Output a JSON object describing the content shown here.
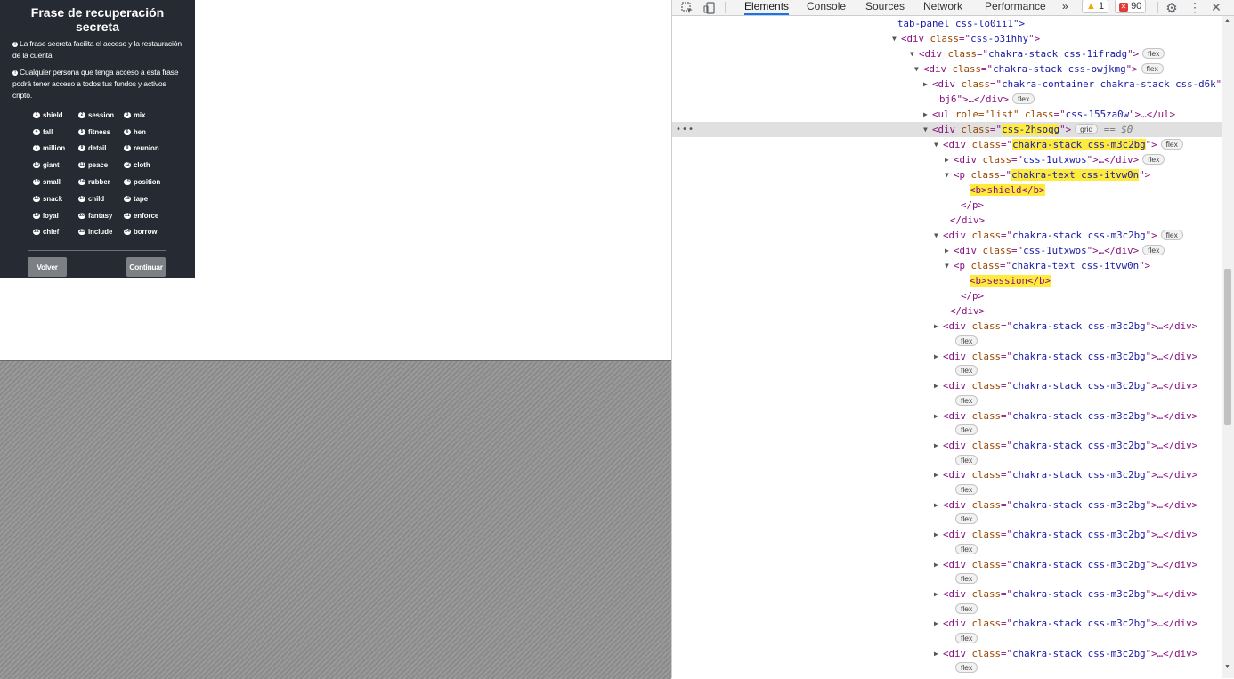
{
  "wallet": {
    "title": "Frase de recuperación secreta",
    "info": [
      "La frase secreta facilita el acceso y la restauración de la cuenta.",
      "Cualquier persona que tenga acceso a esta frase podrá tener acceso a todos tus fundos y activos cripto."
    ],
    "words": [
      {
        "n": "1",
        "w": "shield"
      },
      {
        "n": "2",
        "w": "session"
      },
      {
        "n": "3",
        "w": "mix"
      },
      {
        "n": "4",
        "w": "fall"
      },
      {
        "n": "5",
        "w": "fitness"
      },
      {
        "n": "6",
        "w": "hen"
      },
      {
        "n": "7",
        "w": "million"
      },
      {
        "n": "8",
        "w": "detail"
      },
      {
        "n": "9",
        "w": "reunion"
      },
      {
        "n": "10",
        "w": "giant"
      },
      {
        "n": "11",
        "w": "peace"
      },
      {
        "n": "12",
        "w": "cloth"
      },
      {
        "n": "13",
        "w": "small"
      },
      {
        "n": "14",
        "w": "rubber"
      },
      {
        "n": "15",
        "w": "position"
      },
      {
        "n": "16",
        "w": "snack"
      },
      {
        "n": "17",
        "w": "child"
      },
      {
        "n": "18",
        "w": "tape"
      },
      {
        "n": "19",
        "w": "loyal"
      },
      {
        "n": "20",
        "w": "fantasy"
      },
      {
        "n": "21",
        "w": "enforce"
      },
      {
        "n": "22",
        "w": "chief"
      },
      {
        "n": "23",
        "w": "include"
      },
      {
        "n": "24",
        "w": "borrow"
      }
    ],
    "back_label": "Volver",
    "continue_label": "Continuar"
  },
  "devtools": {
    "tabs": [
      "Elements",
      "Console",
      "Sources",
      "Network",
      "Performance"
    ],
    "active_tab": "Elements",
    "more_tabs": "»",
    "warnings_count": "1",
    "errors_count": "90",
    "selected_suffix": "== $0",
    "lines": [
      {
        "indent": "",
        "tri": "",
        "html": "tab-panel css-lo0ii1\">"
      },
      {
        "tri": "▼",
        "tag": "div",
        "attr": "class",
        "val": "css-o3ihhy",
        "close": ">"
      },
      {
        "tri": "▼",
        "tag": "div",
        "attr": "class",
        "val": "chakra-stack css-1ifradg",
        "close": ">",
        "badge": "flex"
      },
      {
        "tri": "▼",
        "tag": "div",
        "attr": "class",
        "val": "chakra-stack css-owjkmg",
        "close": ">",
        "badge": "flex"
      },
      {
        "tri": "▶",
        "tag": "div",
        "attr": "class",
        "val": "chakra-container chakra-stack css-d6k",
        "close": ""
      },
      {
        "tri": "",
        "text": "bj6\">…</div>",
        "badge": "flex"
      },
      {
        "tri": "▶",
        "tag": "ul",
        "extra": " role=\"list\"",
        "attr": "class",
        "val": "css-155za0w",
        "close": ">…</ul>"
      },
      {
        "tri": "▼",
        "tag": "div",
        "attr": "class",
        "val": "css-2hsoqg",
        "close": ">",
        "badge": "grid",
        "selected": true
      },
      {
        "tri": "▼",
        "tag": "div",
        "attr": "class",
        "val": "chakra-stack css-m3c2bg",
        "close": ">",
        "badge": "flex"
      },
      {
        "tri": "▶",
        "tag": "div",
        "attr": "class",
        "val": "css-1utxwos",
        "close": ">…</div>",
        "badge": "flex"
      },
      {
        "tri": "▼",
        "tag": "p",
        "attr": "class",
        "val": "chakra-text css-itvw0n",
        "close": ">"
      },
      {
        "tri": "",
        "text": "<b>shield</b>"
      },
      {
        "tri": "",
        "text": "</p>"
      },
      {
        "tri": "",
        "text": "</div>"
      },
      {
        "tri": "▼",
        "tag": "div",
        "attr": "class",
        "val": "chakra-stack css-m3c2bg",
        "close": ">",
        "badge": "flex"
      },
      {
        "tri": "▶",
        "tag": "div",
        "attr": "class",
        "val": "css-1utxwos",
        "close": ">…</div>",
        "badge": "flex"
      },
      {
        "tri": "▼",
        "tag": "p",
        "attr": "class",
        "val": "chakra-text css-itvw0n",
        "close": ">"
      },
      {
        "tri": "",
        "text": "<b>session</b>"
      },
      {
        "tri": "",
        "text": "</p>"
      },
      {
        "tri": "",
        "text": "</div>"
      },
      {
        "tri": "▶",
        "tag": "div",
        "attr": "class",
        "val": "chakra-stack css-m3c2bg",
        "close": ">…</div>"
      },
      {
        "tri": "",
        "badge": "flex"
      },
      {
        "tri": "▶",
        "tag": "div",
        "attr": "class",
        "val": "chakra-stack css-m3c2bg",
        "close": ">…</div>"
      },
      {
        "tri": "",
        "badge": "flex"
      },
      {
        "tri": "▶",
        "tag": "div",
        "attr": "class",
        "val": "chakra-stack css-m3c2bg",
        "close": ">…</div>"
      },
      {
        "tri": "",
        "badge": "flex"
      },
      {
        "tri": "▶",
        "tag": "div",
        "attr": "class",
        "val": "chakra-stack css-m3c2bg",
        "close": ">…</div>"
      },
      {
        "tri": "",
        "badge": "flex"
      },
      {
        "tri": "▶",
        "tag": "div",
        "attr": "class",
        "val": "chakra-stack css-m3c2bg",
        "close": ">…</div>"
      },
      {
        "tri": "",
        "badge": "flex"
      },
      {
        "tri": "▶",
        "tag": "div",
        "attr": "class",
        "val": "chakra-stack css-m3c2bg",
        "close": ">…</div>"
      },
      {
        "tri": "",
        "badge": "flex"
      },
      {
        "tri": "▶",
        "tag": "div",
        "attr": "class",
        "val": "chakra-stack css-m3c2bg",
        "close": ">…</div>"
      },
      {
        "tri": "",
        "badge": "flex"
      },
      {
        "tri": "▶",
        "tag": "div",
        "attr": "class",
        "val": "chakra-stack css-m3c2bg",
        "close": ">…</div>"
      },
      {
        "tri": "",
        "badge": "flex"
      },
      {
        "tri": "▶",
        "tag": "div",
        "attr": "class",
        "val": "chakra-stack css-m3c2bg",
        "close": ">…</div>"
      },
      {
        "tri": "",
        "badge": "flex"
      },
      {
        "tri": "▶",
        "tag": "div",
        "attr": "class",
        "val": "chakra-stack css-m3c2bg",
        "close": ">…</div>"
      },
      {
        "tri": "",
        "badge": "flex"
      },
      {
        "tri": "▶",
        "tag": "div",
        "attr": "class",
        "val": "chakra-stack css-m3c2bg",
        "close": ">…</div>"
      },
      {
        "tri": "",
        "badge": "flex"
      },
      {
        "tri": "▶",
        "tag": "div",
        "attr": "class",
        "val": "chakra-stack css-m3c2bg",
        "close": ">…</div>"
      },
      {
        "tri": "",
        "badge": "flex"
      }
    ]
  },
  "icons": {
    "inspect": "inspect-element-icon",
    "device": "device-toolbar-icon",
    "settings": "gear-icon",
    "menu": "kebab-menu-icon",
    "close": "close-icon"
  }
}
